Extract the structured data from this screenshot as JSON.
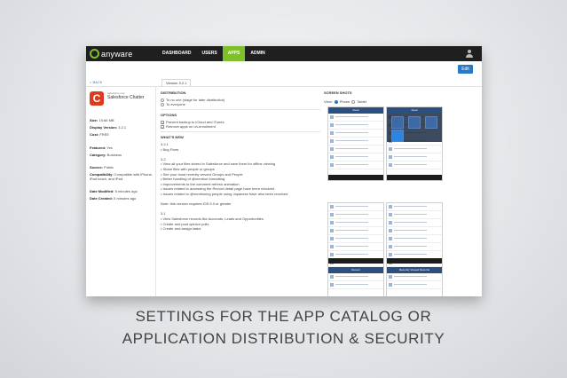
{
  "nav": {
    "logo": "anyware",
    "items": [
      "DASHBOARD",
      "USERS",
      "APPS",
      "ADMIN"
    ],
    "active_index": 2
  },
  "toolbar": {
    "edit_label": "Edit"
  },
  "back_label": "< BACK",
  "tab_label": "Version 3.2.1",
  "app": {
    "source": "salesforce.com",
    "name": "Salesforce Chatter",
    "details": [
      {
        "key": "Size:",
        "value": "19.66 MB"
      },
      {
        "key": "Display Version:",
        "value": "3.2.1"
      },
      {
        "key": "Cost:",
        "value": "FREE"
      },
      {
        "key": "Featured:",
        "value": "Yes"
      },
      {
        "key": "Category:",
        "value": "Business"
      },
      {
        "key": "Source:",
        "value": "Public"
      },
      {
        "key": "Compatibility:",
        "value": "Compatible with iPhone, iPad touch, and iPad."
      },
      {
        "key": "Date Modified:",
        "value": "5 minutes ago"
      },
      {
        "key": "Date Created:",
        "value": "5 minutes ago"
      }
    ]
  },
  "distribution": {
    "heading": "DISTRIBUTION",
    "options": [
      "To no one (stage for later distribution)",
      "To everyone"
    ]
  },
  "options": {
    "heading": "OPTIONS",
    "items": [
      "Prevent backup to iCloud and iTunes",
      "Remove apps on un-enrollment"
    ]
  },
  "whats_new": {
    "heading": "WHAT'S NEW",
    "lines": [
      "3.2.1",
      "• Bug Fixes",
      "",
      "3.2",
      "• View all your files stored in Salesforce and save them for offline viewing",
      "• Share files with people or groups",
      "• See your most recently viewed Groups and People",
      "• Better handling of @mention formatting",
      "• Improvements to the comment refresh animation",
      "• Issues related to accessing the Record detail page have been resolved",
      "• Issues related to @mentioning people using Japanese have also been resolved",
      "",
      "Note: this version requires iOS 5.0 or greater",
      "",
      "3.1",
      "• View Salesforce records like Accounts, Leads and Opportunities",
      "• Create and post opinion polls",
      "• Create and assign tasks"
    ]
  },
  "screenshots": {
    "heading": "SCREEN SHOTS",
    "view_label": "View:",
    "view_options": [
      "Phone",
      "Tablet"
    ],
    "phones": [
      {
        "title": "Feed"
      },
      {
        "title": "Feed"
      },
      {
        "title": "Recent"
      },
      {
        "title": "Recently Viewed Records"
      }
    ]
  },
  "caption": {
    "line1": "SETTINGS FOR THE APP CATALOG OR",
    "line2": "APPLICATION DISTRIBUTION & SECURITY"
  },
  "colors": {
    "accent": "#7fbf2a",
    "button": "#2a79c8",
    "app_icon": "#e03a1e",
    "phone_header": "#2b4f7e"
  }
}
